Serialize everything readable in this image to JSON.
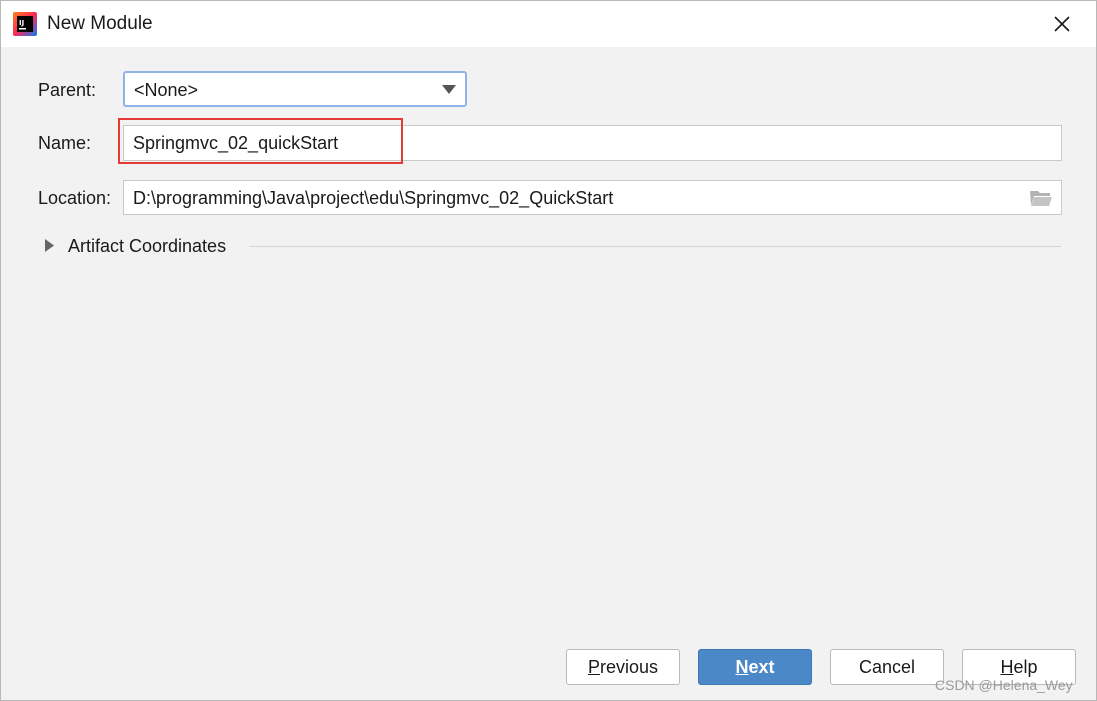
{
  "window": {
    "title": "New Module",
    "app_icon": "intellij-idea-icon",
    "close_icon": "close-icon"
  },
  "form": {
    "parent_label": "Parent:",
    "parent_value": "<None>",
    "name_label": "Name:",
    "name_value": "Springmvc_02_quickStart",
    "location_label": "Location:",
    "location_value": "D:\\programming\\Java\\project\\edu\\Springmvc_02_QuickStart",
    "artifact_label": "Artifact Coordinates"
  },
  "buttons": {
    "previous_mnemonic": "P",
    "previous_rest": "revious",
    "next_mnemonic": "N",
    "next_rest": "ext",
    "cancel": "Cancel",
    "help_mnemonic": "H",
    "help_rest": "elp"
  },
  "colors": {
    "primary_button": "#4a88c7",
    "highlight_box": "#e53935",
    "focus_border": "#8fb3e6"
  },
  "watermark": "CSDN @Helena_Wey"
}
